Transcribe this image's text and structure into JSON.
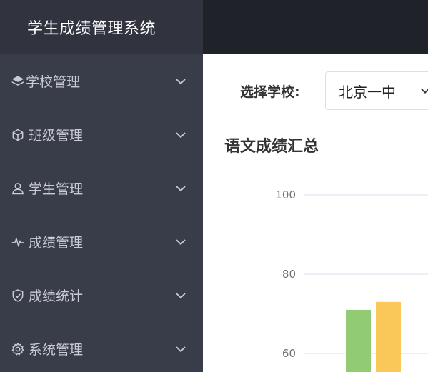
{
  "sidebar": {
    "title": "学生成绩管理系统",
    "items": [
      {
        "label": "学校管理",
        "icon": "layers-icon"
      },
      {
        "label": "班级管理",
        "icon": "cube-icon"
      },
      {
        "label": "学生管理",
        "icon": "user-icon"
      },
      {
        "label": "成绩管理",
        "icon": "pulse-icon"
      },
      {
        "label": "成绩统计",
        "icon": "shield-check-icon"
      },
      {
        "label": "系统管理",
        "icon": "gear-icon"
      }
    ]
  },
  "filter": {
    "school_label": "选择学校:",
    "school_value": "北京一中"
  },
  "colors": {
    "sidebar_bg": "#393d49",
    "header_bg": "#20222a",
    "bar_green": "#91cc75",
    "bar_yellow": "#fac858"
  },
  "chart_data": {
    "type": "bar",
    "title": "语文成绩汇总",
    "ylim_visible": [
      57,
      100
    ],
    "yticks": [
      100,
      80,
      60
    ],
    "gridlines": true,
    "series": [
      {
        "color": "#91cc75",
        "values": [
          71
        ]
      },
      {
        "color": "#fac858",
        "values": [
          73
        ]
      }
    ]
  }
}
